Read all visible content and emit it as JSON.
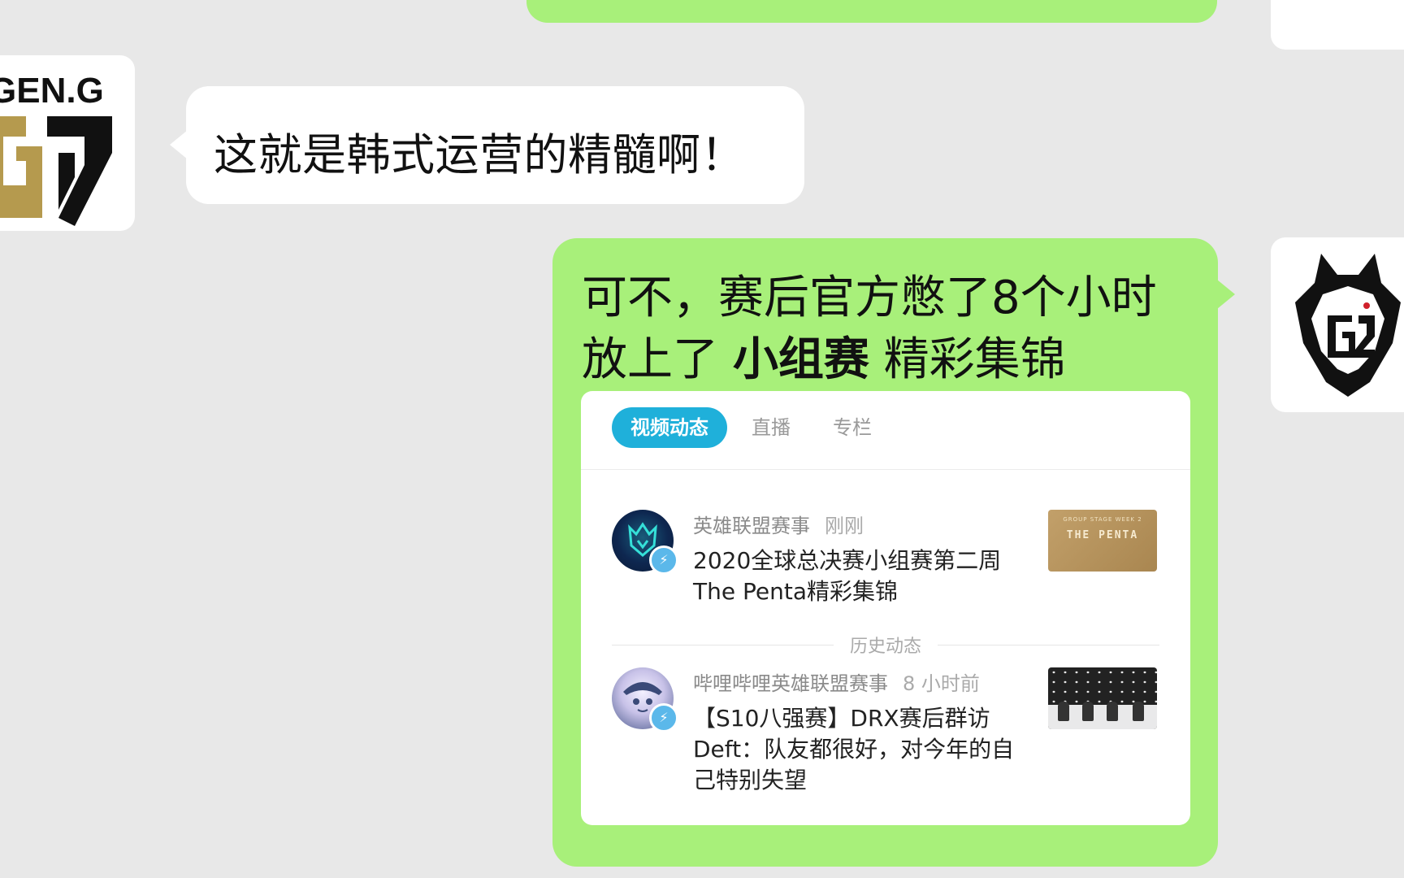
{
  "chat": {
    "incoming_message": "这就是韩式运营的精髓啊！",
    "incoming_avatar": {
      "name": "GEN.G",
      "icon": "geng-logo"
    },
    "outgoing_avatar": {
      "icon": "g2-logo"
    },
    "outgoing_message_line1": "可不，赛后官方憋了8个小时",
    "outgoing_message_line2_pre": "放上了",
    "outgoing_message_line2_bold": "小组赛",
    "outgoing_message_line2_post": "精彩集锦",
    "bubble_color": "#a8f07a"
  },
  "card": {
    "tabs": [
      {
        "label": "视频动态",
        "active": true
      },
      {
        "label": "直播",
        "active": false
      },
      {
        "label": "专栏",
        "active": false
      }
    ],
    "items": [
      {
        "author": "英雄联盟赛事",
        "time": "刚刚",
        "title": "2020全球总决赛小组赛第二周 The Penta精彩集锦",
        "thumb_text": "THE PENTA",
        "thumb_subtext": "GROUP STAGE WEEK 2"
      },
      {
        "author": "哔哩哔哩英雄联盟赛事",
        "time": "8 小时前",
        "title": "【S10八强赛】DRX赛后群访 Deft：队友都很好，对今年的自己特别失望"
      }
    ],
    "divider_label": "历史动态",
    "accent_color": "#1fb0da"
  }
}
